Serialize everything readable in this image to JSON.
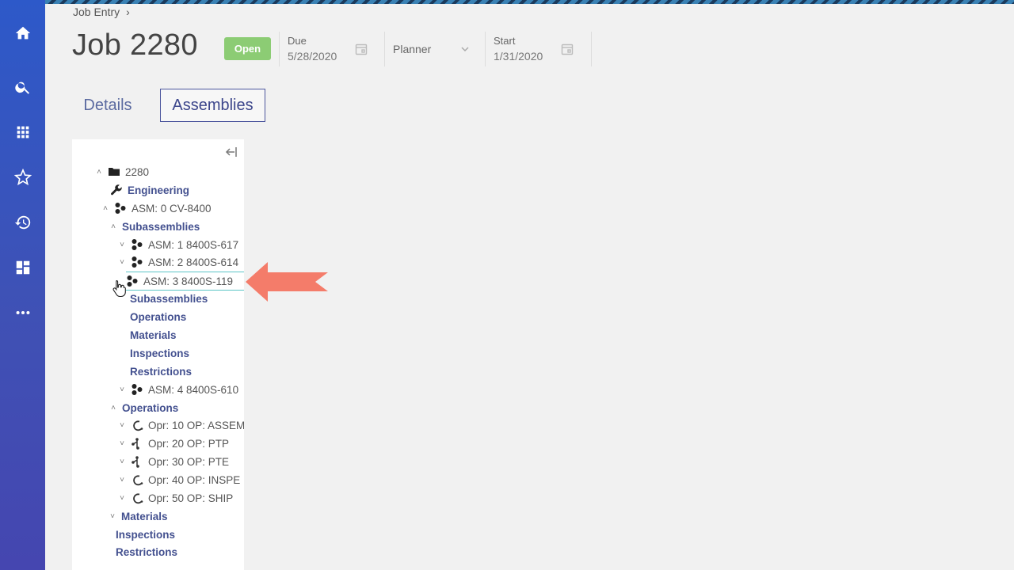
{
  "breadcrumb": {
    "label": "Job Entry",
    "separator": "›"
  },
  "header": {
    "title": "Job 2280",
    "status": "Open",
    "due": {
      "label": "Due",
      "value": "5/28/2020"
    },
    "planner": {
      "label": "Planner"
    },
    "start": {
      "label": "Start",
      "value": "1/31/2020"
    }
  },
  "tabs": [
    {
      "label": "Details",
      "active": false
    },
    {
      "label": "Assemblies",
      "active": true
    }
  ],
  "sidebar": {
    "items": [
      {
        "name": "home",
        "icon": "home-icon"
      },
      {
        "name": "search",
        "icon": "search-icon"
      },
      {
        "name": "apps",
        "icon": "grid-icon"
      },
      {
        "name": "favorites",
        "icon": "star-icon"
      },
      {
        "name": "history",
        "icon": "history-icon"
      },
      {
        "name": "dashboard",
        "icon": "dashboard-icon"
      },
      {
        "name": "more",
        "icon": "more-icon"
      }
    ]
  },
  "tree": {
    "rows": [
      {
        "label": "2280",
        "icon": "folder",
        "toggle": "^",
        "bold": false
      },
      {
        "label": "Engineering",
        "icon": "wrench",
        "toggle": "",
        "bold": true
      },
      {
        "label": "ASM: 0 CV-8400",
        "icon": "assembly",
        "toggle": "^",
        "bold": false
      },
      {
        "label": "Subassemblies",
        "icon": "",
        "toggle": "^",
        "bold": true
      },
      {
        "label": "ASM: 1 8400S-617",
        "icon": "assembly",
        "toggle": "v",
        "bold": false
      },
      {
        "label": "ASM: 2 8400S-614",
        "icon": "assembly",
        "toggle": "v",
        "bold": false
      },
      {
        "label": "ASM: 3 8400S-119",
        "icon": "assembly",
        "toggle": "",
        "bold": false,
        "selected": true
      },
      {
        "label": "Subassemblies",
        "icon": "",
        "toggle": "",
        "bold": true
      },
      {
        "label": "Operations",
        "icon": "",
        "toggle": "",
        "bold": true
      },
      {
        "label": "Materials",
        "icon": "",
        "toggle": "",
        "bold": true
      },
      {
        "label": "Inspections",
        "icon": "",
        "toggle": "",
        "bold": true
      },
      {
        "label": "Restrictions",
        "icon": "",
        "toggle": "",
        "bold": true
      },
      {
        "label": "ASM: 4 8400S-610",
        "icon": "assembly",
        "toggle": "v",
        "bold": false
      },
      {
        "label": "Operations",
        "icon": "",
        "toggle": "^",
        "bold": true
      },
      {
        "label": "Opr: 10 OP: ASSEM",
        "icon": "operation-arc",
        "toggle": "v",
        "bold": false
      },
      {
        "label": "Opr: 20 OP: PTP",
        "icon": "operation-fork",
        "toggle": "v",
        "bold": false
      },
      {
        "label": "Opr: 30 OP: PTE",
        "icon": "operation-fork",
        "toggle": "v",
        "bold": false
      },
      {
        "label": "Opr: 40 OP: INSPE",
        "icon": "operation-arc",
        "toggle": "v",
        "bold": false
      },
      {
        "label": "Opr: 50 OP: SHIP",
        "icon": "operation-arc",
        "toggle": "v",
        "bold": false
      },
      {
        "label": "Materials",
        "icon": "",
        "toggle": "v",
        "bold": true
      },
      {
        "label": "Inspections",
        "icon": "",
        "toggle": "",
        "bold": true
      },
      {
        "label": "Restrictions",
        "icon": "",
        "toggle": "",
        "bold": true
      }
    ]
  },
  "colors": {
    "sidebar": "#3f51b5",
    "status": "#8ccc74",
    "tree_label": "#43508f",
    "selection_border": "#5bc5c6",
    "arrow": "#f47c6a"
  }
}
